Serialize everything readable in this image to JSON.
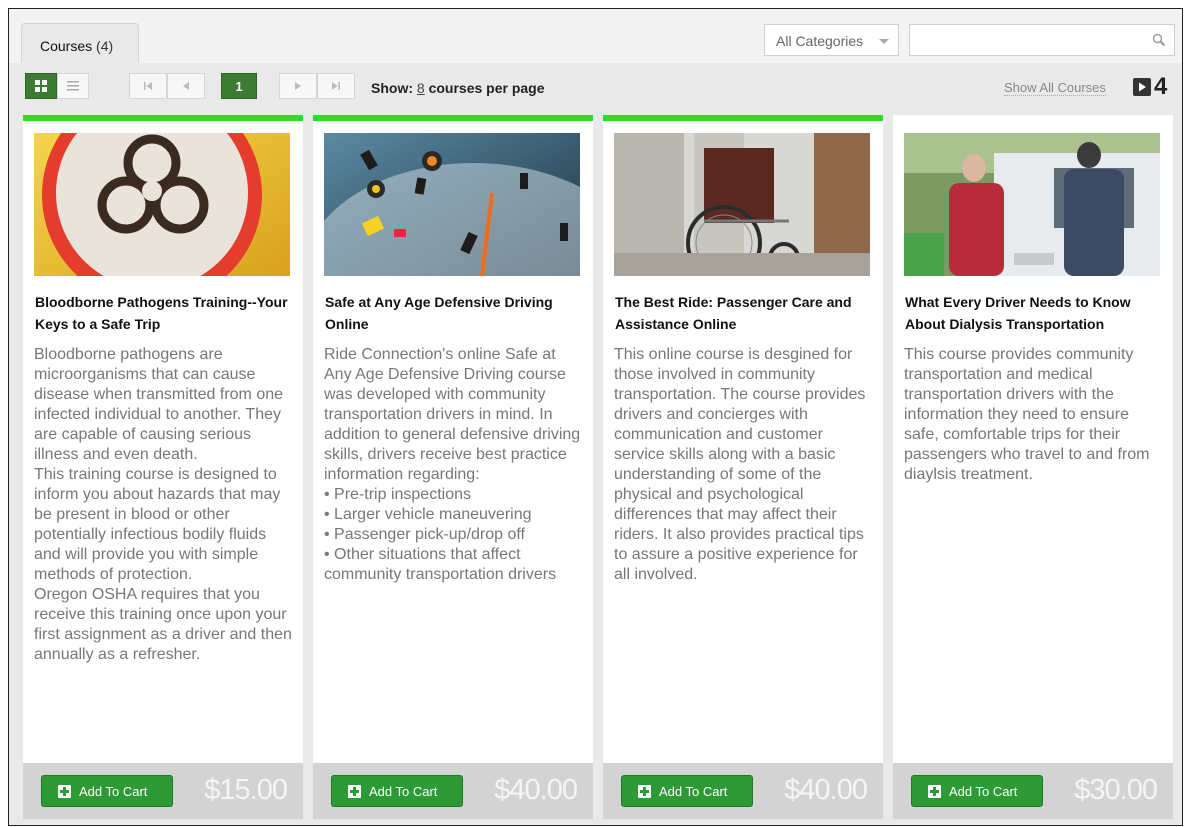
{
  "header": {
    "tab_label": "Courses",
    "tab_count": "(4)",
    "category_select": "All Categories",
    "search_placeholder": ""
  },
  "toolbar": {
    "current_page": "1",
    "show_prefix": "Show:",
    "per_page": "8",
    "show_suffix": "courses per page",
    "show_all_label": "Show All Courses",
    "total_count": "4"
  },
  "colors": {
    "accent_green": "#27e02a",
    "button_green": "#2d9a35",
    "active_green": "#3d7a32"
  },
  "courses": [
    {
      "title": "Bloodborne Pathogens Training--Your Keys to a Safe Trip",
      "description": "Bloodborne pathogens are microorganisms that can cause disease when transmitted from one infected individual to another.  They are capable of causing serious illness and even death.\nThis training course is designed to inform you about hazards that may be present in blood or other potentially infectious bodily fluids and will provide you with simple methods of protection.\nOregon OSHA requires that you receive this training once upon your first assignment as a driver and then annually as a refresher.",
      "button": "Add To Cart",
      "price": "$15.00",
      "highlighted": true,
      "image": "biohazard-symbol-image"
    },
    {
      "title": "Safe at Any Age Defensive Driving Online",
      "description": "Ride Connection's online Safe at Any Age Defensive Driving course was developed with community transportation drivers in mind. In addition to general defensive driving skills, drivers receive best practice information regarding:\n• Pre-trip inspections\n• Larger vehicle maneuvering\n• Passenger pick-up/drop off\n• Other situations that affect community transportation drivers",
      "button": "Add To Cart",
      "price": "$40.00",
      "highlighted": true,
      "image": "dashboard-gauges-image"
    },
    {
      "title": "The Best Ride: Passenger Care and Assistance Online",
      "description": "This online course is desgined for those involved in community transportation. The course provides drivers and concierges with communication and customer service skills along with a basic understanding of some of the physical and psychological differences that may affect their riders. It also provides practical tips to assure a positive experience for all involved.",
      "button": "Add To Cart",
      "price": "$40.00",
      "highlighted": true,
      "image": "wheelchair-image"
    },
    {
      "title": "What Every Driver Needs to Know About Dialysis Transportation",
      "description": "This course provides community transportation and medical transportation drivers with the information they need to ensure safe, comfortable trips for their passengers who travel to and from diaylsis treatment.",
      "button": "Add To Cart",
      "price": "$30.00",
      "highlighted": false,
      "image": "driver-assisting-passenger-image"
    }
  ]
}
